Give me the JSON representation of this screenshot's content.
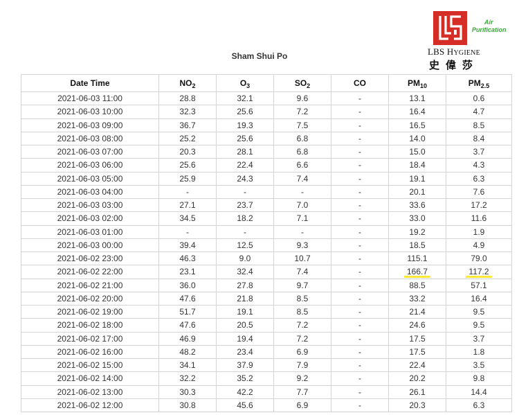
{
  "station": "Sham Shui Po",
  "logo": {
    "brand_main": "LBS H",
    "brand_smallcaps": "YGIENE",
    "chinese_name": "史偉莎",
    "tagline_line1": "Air",
    "tagline_line2": "Purification",
    "brand_color": "#d42e26",
    "tagline_color": "#38a838"
  },
  "table": {
    "headers": [
      {
        "base": "Date Time",
        "sub": ""
      },
      {
        "base": "NO",
        "sub": "2"
      },
      {
        "base": "O",
        "sub": "3"
      },
      {
        "base": "SO",
        "sub": "2"
      },
      {
        "base": "CO",
        "sub": ""
      },
      {
        "base": "PM",
        "sub": "10"
      },
      {
        "base": "PM",
        "sub": "2.5"
      }
    ],
    "rows": [
      [
        "2021-06-03 11:00",
        "28.8",
        "32.1",
        "9.6",
        "-",
        "13.1",
        "0.6"
      ],
      [
        "2021-06-03 10:00",
        "32.3",
        "25.6",
        "7.2",
        "-",
        "16.4",
        "4.7"
      ],
      [
        "2021-06-03 09:00",
        "36.7",
        "19.3",
        "7.5",
        "-",
        "16.5",
        "8.5"
      ],
      [
        "2021-06-03 08:00",
        "25.2",
        "25.6",
        "6.8",
        "-",
        "14.0",
        "8.4"
      ],
      [
        "2021-06-03 07:00",
        "20.3",
        "28.1",
        "6.8",
        "-",
        "15.0",
        "3.7"
      ],
      [
        "2021-06-03 06:00",
        "25.6",
        "22.4",
        "6.6",
        "-",
        "18.4",
        "4.3"
      ],
      [
        "2021-06-03 05:00",
        "25.9",
        "24.3",
        "7.4",
        "-",
        "19.1",
        "6.3"
      ],
      [
        "2021-06-03 04:00",
        "-",
        "-",
        "-",
        "-",
        "20.1",
        "7.6"
      ],
      [
        "2021-06-03 03:00",
        "27.1",
        "23.7",
        "7.0",
        "-",
        "33.6",
        "17.2"
      ],
      [
        "2021-06-03 02:00",
        "34.5",
        "18.2",
        "7.1",
        "-",
        "33.0",
        "11.6"
      ],
      [
        "2021-06-03 01:00",
        "-",
        "-",
        "-",
        "-",
        "19.2",
        "1.9"
      ],
      [
        "2021-06-03 00:00",
        "39.4",
        "12.5",
        "9.3",
        "-",
        "18.5",
        "4.9"
      ],
      [
        "2021-06-02 23:00",
        "46.3",
        "9.0",
        "10.7",
        "-",
        "115.1",
        "79.0"
      ],
      [
        "2021-06-02 22:00",
        "23.1",
        "32.4",
        "7.4",
        "-",
        "166.7",
        "117.2"
      ],
      [
        "2021-06-02 21:00",
        "36.0",
        "27.8",
        "9.7",
        "-",
        "88.5",
        "57.1"
      ],
      [
        "2021-06-02 20:00",
        "47.6",
        "21.8",
        "8.5",
        "-",
        "33.2",
        "16.4"
      ],
      [
        "2021-06-02 19:00",
        "51.7",
        "19.1",
        "8.5",
        "-",
        "21.4",
        "9.5"
      ],
      [
        "2021-06-02 18:00",
        "47.6",
        "20.5",
        "7.2",
        "-",
        "24.6",
        "9.5"
      ],
      [
        "2021-06-02 17:00",
        "46.9",
        "19.4",
        "7.2",
        "-",
        "17.5",
        "3.7"
      ],
      [
        "2021-06-02 16:00",
        "48.2",
        "23.4",
        "6.9",
        "-",
        "17.5",
        "1.8"
      ],
      [
        "2021-06-02 15:00",
        "34.1",
        "37.9",
        "7.9",
        "-",
        "22.4",
        "3.5"
      ],
      [
        "2021-06-02 14:00",
        "32.2",
        "35.2",
        "9.2",
        "-",
        "20.2",
        "9.8"
      ],
      [
        "2021-06-02 13:00",
        "30.3",
        "42.2",
        "7.7",
        "-",
        "26.1",
        "14.4"
      ],
      [
        "2021-06-02 12:00",
        "30.8",
        "45.6",
        "6.9",
        "-",
        "20.3",
        "6.3"
      ]
    ],
    "highlight": {
      "row": 13,
      "columns": [
        5,
        6
      ],
      "color": "#ffe936"
    }
  }
}
